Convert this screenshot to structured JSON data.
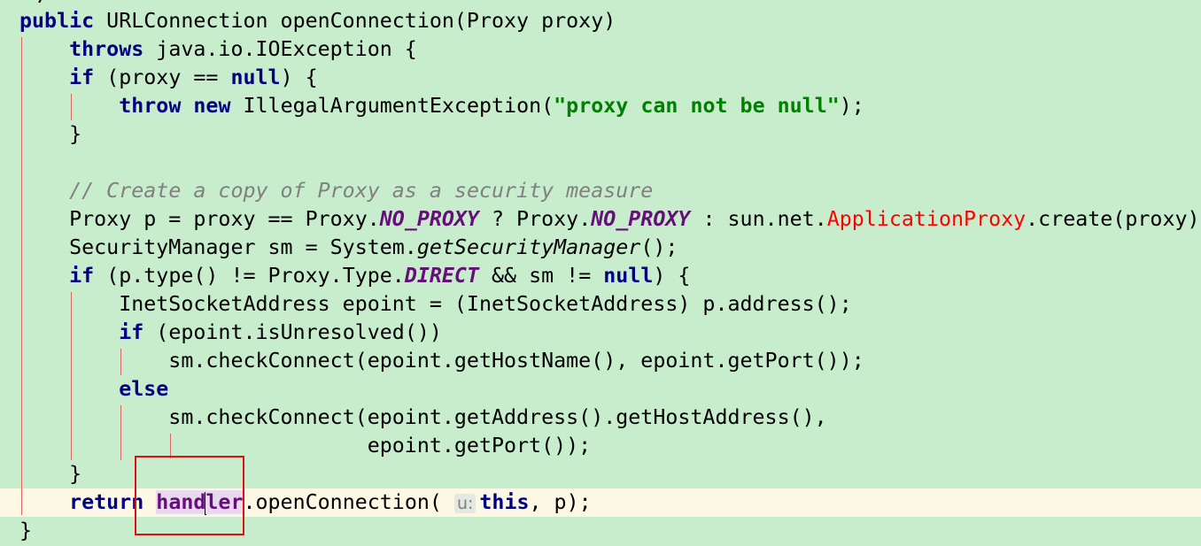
{
  "editor": {
    "top_fragment": "*/",
    "lines": [
      [
        [
          "kw",
          "public"
        ],
        [
          "t",
          " URLConnection openConnection(Proxy proxy)"
        ]
      ],
      [
        [
          "t",
          "    "
        ],
        [
          "kw",
          "throws"
        ],
        [
          "t",
          " java.io.IOException {"
        ]
      ],
      [
        [
          "t",
          "    "
        ],
        [
          "kw",
          "if"
        ],
        [
          "t",
          " (proxy == "
        ],
        [
          "kw",
          "null"
        ],
        [
          "t",
          ") {"
        ]
      ],
      [
        [
          "t",
          "        "
        ],
        [
          "kw",
          "throw"
        ],
        [
          "t",
          " "
        ],
        [
          "kw",
          "new"
        ],
        [
          "t",
          " IllegalArgumentException("
        ],
        [
          "str",
          "\"proxy can not be null\""
        ],
        [
          "t",
          ");"
        ]
      ],
      [
        [
          "t",
          "    }"
        ]
      ],
      [
        [
          "t",
          ""
        ]
      ],
      [
        [
          "t",
          "    "
        ],
        [
          "cmt",
          "// Create a copy of Proxy as a security measure"
        ]
      ],
      [
        [
          "t",
          "    Proxy p = proxy == Proxy."
        ],
        [
          "const",
          "NO_PROXY"
        ],
        [
          "t",
          " ? Proxy."
        ],
        [
          "const",
          "NO_PROXY"
        ],
        [
          "t",
          " : sun.net."
        ],
        [
          "cls",
          "ApplicationProxy"
        ],
        [
          "t",
          ".create(proxy);"
        ]
      ],
      [
        [
          "t",
          "    SecurityManager sm = System."
        ],
        [
          "static",
          "getSecurityManager"
        ],
        [
          "t",
          "();"
        ]
      ],
      [
        [
          "t",
          "    "
        ],
        [
          "kw",
          "if"
        ],
        [
          "t",
          " (p.type() != Proxy.Type."
        ],
        [
          "const",
          "DIRECT"
        ],
        [
          "t",
          " && sm != "
        ],
        [
          "kw",
          "null"
        ],
        [
          "t",
          ") {"
        ]
      ],
      [
        [
          "t",
          "        InetSocketAddress epoint = (InetSocketAddress) p.address();"
        ]
      ],
      [
        [
          "t",
          "        "
        ],
        [
          "kw",
          "if"
        ],
        [
          "t",
          " (epoint.isUnresolved())"
        ]
      ],
      [
        [
          "t",
          "            sm.checkConnect(epoint.getHostName(), epoint.getPort());"
        ]
      ],
      [
        [
          "t",
          "        "
        ],
        [
          "kw",
          "else"
        ]
      ],
      [
        [
          "t",
          "            sm.checkConnect(epoint.getAddress().getHostAddress(),"
        ]
      ],
      [
        [
          "t",
          "                            epoint.getPort());"
        ]
      ],
      [
        [
          "t",
          "    }"
        ]
      ],
      [
        [
          "t",
          "    "
        ],
        [
          "kw",
          "return"
        ],
        [
          "t",
          " "
        ],
        [
          "fld",
          "hand"
        ],
        [
          "caret",
          ""
        ],
        [
          "fld",
          "ler"
        ],
        [
          "t",
          ".openConnection( "
        ],
        [
          "hint",
          "u:"
        ],
        [
          "kw",
          "this"
        ],
        [
          "t",
          ", p);"
        ]
      ],
      [
        [
          "t",
          "}"
        ]
      ]
    ],
    "current_line_index": 17
  }
}
